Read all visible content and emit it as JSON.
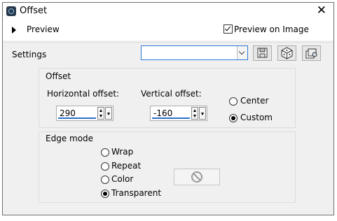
{
  "window": {
    "title": "Offset",
    "close_glyph": "✕"
  },
  "preview": {
    "label": "Preview",
    "preview_on_image_label": "Preview on Image",
    "preview_on_image_checked": true
  },
  "settings": {
    "label": "Settings",
    "preset_value": "",
    "tools": [
      {
        "name": "save-preset-icon"
      },
      {
        "name": "randomize-dice-icon"
      },
      {
        "name": "manage-presets-icon"
      }
    ]
  },
  "offset": {
    "group_title": "Offset",
    "horizontal_label": "Horizontal offset:",
    "horizontal_value": "290",
    "vertical_label": "Vertical offset:",
    "vertical_value": "-160",
    "center_label": "Center",
    "custom_label": "Custom",
    "selected": "custom"
  },
  "edge_mode": {
    "group_title": "Edge mode",
    "options": [
      "Wrap",
      "Repeat",
      "Color",
      "Transparent"
    ],
    "selected": "Transparent",
    "color_button_icon": "no-symbol-icon",
    "color_button_disabled": true
  }
}
